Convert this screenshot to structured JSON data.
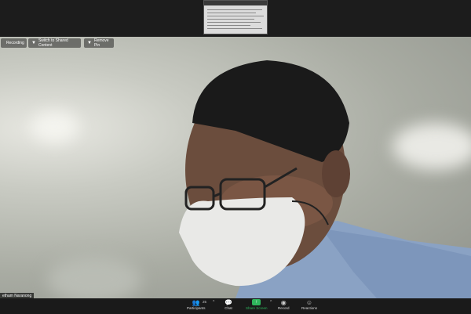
{
  "share_preview": {
    "label": "Shared screen preview"
  },
  "video_controls": {
    "recording_label": "Recording",
    "switch_shared_label": "Switch to Shared Content",
    "remove_pin_label": "Remove Pin"
  },
  "participant": {
    "name": "etham Naranong"
  },
  "toolbar": {
    "participants_label": "Participants",
    "participants_count": "25",
    "chat_label": "Chat",
    "share_label": "Share Screen",
    "record_label": "Record",
    "reactions_label": "Reactions",
    "share_color": "#2fb55c"
  }
}
